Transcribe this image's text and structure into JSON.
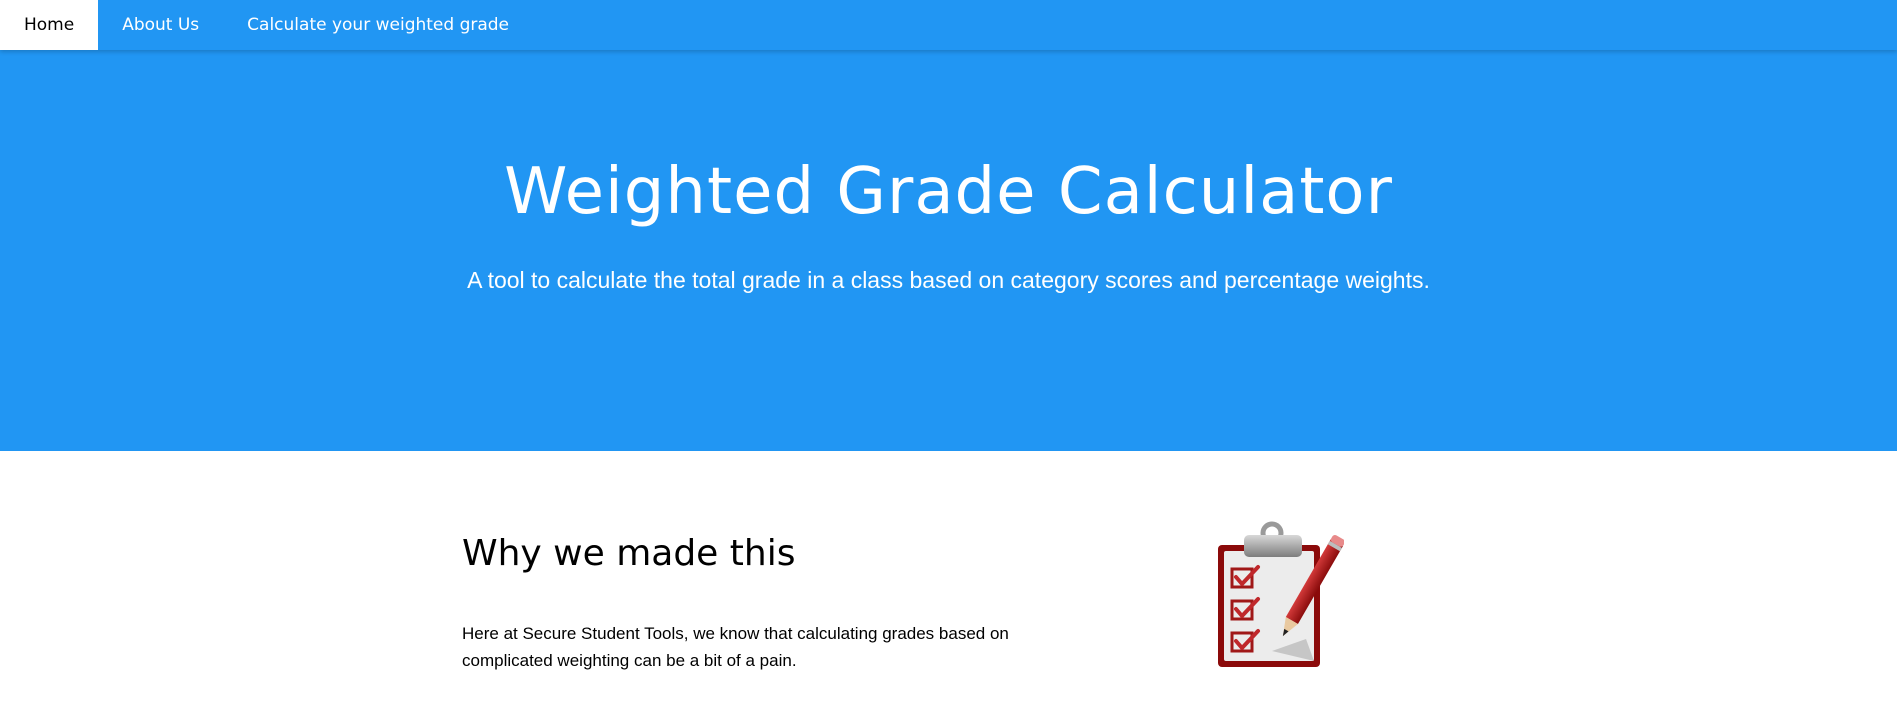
{
  "nav": {
    "items": [
      {
        "label": "Home",
        "active": true
      },
      {
        "label": "About Us",
        "active": false
      },
      {
        "label": "Calculate your weighted grade",
        "active": false
      }
    ]
  },
  "hero": {
    "title": "Weighted Grade Calculator",
    "subtitle": "A tool to calculate the total grade in a class based on category scores and percentage weights."
  },
  "about": {
    "heading": "Why we made this",
    "text": "Here at Secure Student Tools, we know that calculating grades based on complicated weighting can be a bit of a pain.",
    "illustration": "clipboard-checklist-icon"
  },
  "colors": {
    "primary": "#2196F3",
    "clipboard_frame": "#8B0A0A",
    "check": "#C0282B"
  }
}
